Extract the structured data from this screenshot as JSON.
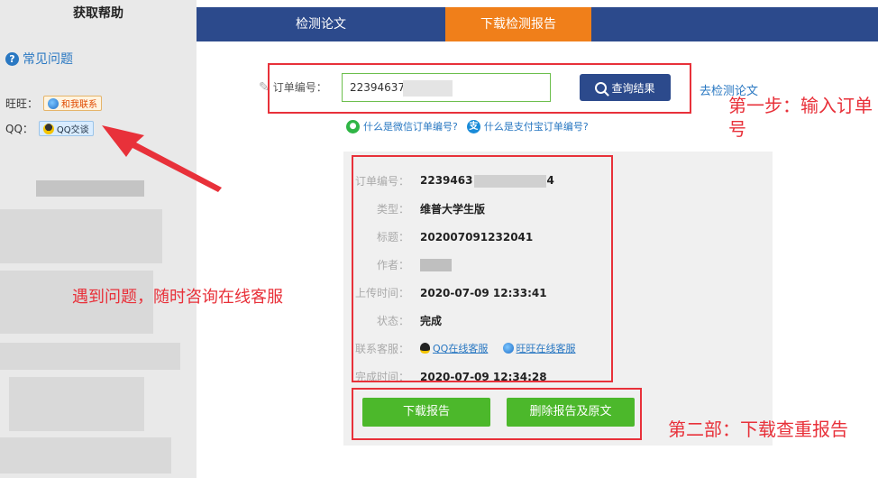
{
  "sidebar": {
    "title": "获取帮助",
    "faq_label": "常见问题",
    "wangwang_label": "旺旺：",
    "wangwang_chip": "和我联系",
    "qq_label": "QQ：",
    "qq_chip": "QQ交谈"
  },
  "nav": {
    "tab_check": "检测论文",
    "tab_download": "下载检测报告"
  },
  "search": {
    "order_label": "订单编号：",
    "order_value": "22394637707",
    "query_button": "查询结果",
    "go_check_link": "去检测论文",
    "wechat_help": "什么是微信订单编号?",
    "alipay_help": "什么是支付宝订单编号?"
  },
  "result": {
    "order_no_label": "订单编号：",
    "order_no_value": "2239463",
    "order_no_suffix": "4",
    "type_label": "类型：",
    "type_value": "维普大学生版",
    "title_label": "标题：",
    "title_value": "202007091232041",
    "author_label": "作者：",
    "upload_label": "上传时间：",
    "upload_value": "2020-07-09 12:33:41",
    "status_label": "状态：",
    "status_value": "完成",
    "service_label": "联系客服：",
    "service_qq": "QQ在线客服",
    "service_ww": "旺旺在线客服",
    "done_label": "完成时间：",
    "done_value": "2020-07-09 12:34:28",
    "download_button": "下载报告",
    "delete_button": "删除报告及原文"
  },
  "annotations": {
    "step1": "第一步：输入订单号",
    "step2": "第二部：下载查重报告",
    "help": "遇到问题，随时咨询在线客服"
  },
  "colors": {
    "nav_bg": "#2c4a8c",
    "nav_active": "#f07f1a",
    "accent_green": "#4cb82b",
    "annotation_red": "#e8313a",
    "link_blue": "#2a78c2"
  }
}
